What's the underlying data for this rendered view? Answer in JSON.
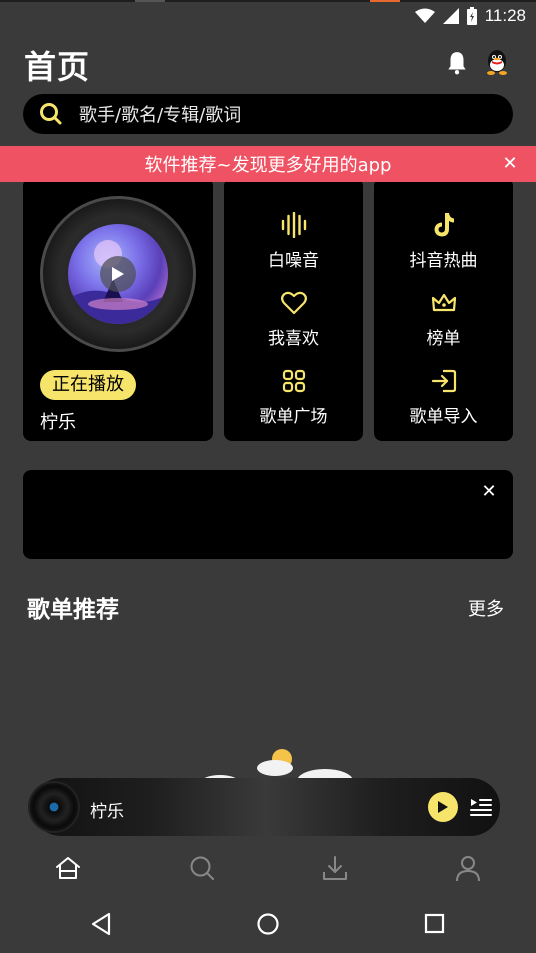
{
  "status_bar": {
    "time": "11:28"
  },
  "header": {
    "title": "首页"
  },
  "search": {
    "placeholder": "歌手/歌名/专辑/歌词"
  },
  "banner": {
    "text": "软件推荐~发现更多好用的app",
    "close": "✕"
  },
  "player_card": {
    "badge": "正在播放",
    "song": "柠乐"
  },
  "quick_grid": {
    "left": [
      {
        "label": "白噪音",
        "icon": "sound-wave-icon"
      },
      {
        "label": "我喜欢",
        "icon": "heart-icon"
      },
      {
        "label": "歌单广场",
        "icon": "grid-icon"
      }
    ],
    "right": [
      {
        "label": "抖音热曲",
        "icon": "tiktok-icon"
      },
      {
        "label": "榜单",
        "icon": "crown-icon"
      },
      {
        "label": "歌单导入",
        "icon": "import-icon"
      }
    ]
  },
  "ad": {
    "close": "✕"
  },
  "recommend": {
    "title": "歌单推荐",
    "more": "更多"
  },
  "mini_player": {
    "song": "柠乐"
  },
  "colors": {
    "accent": "#f7e56b",
    "banner": "#ef5262",
    "background": "#3a3a3a",
    "card": "#000000"
  }
}
